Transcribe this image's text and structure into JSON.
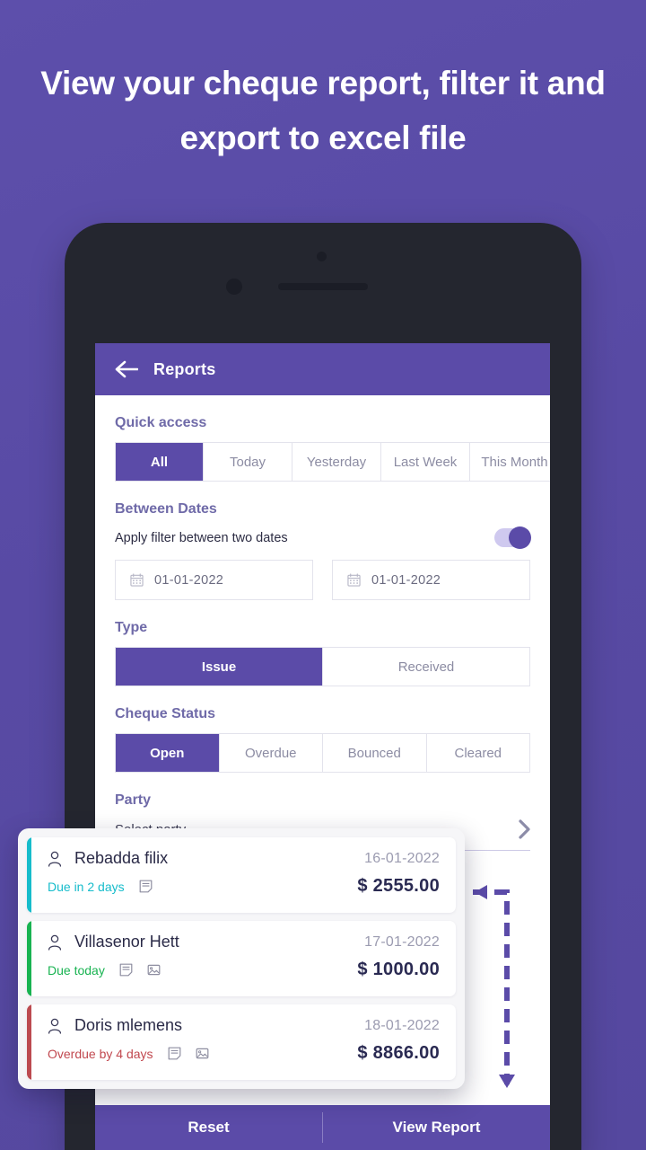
{
  "promo": {
    "headline": "View your cheque report, filter it and export to excel file",
    "background_color": "#584aa4"
  },
  "app": {
    "header": {
      "title": "Reports",
      "back_icon": "arrow-left-icon",
      "color": "#5b4ba8"
    },
    "quick_access": {
      "label": "Quick access",
      "options": [
        "All",
        "Today",
        "Yesterday",
        "Last Week",
        "This Month"
      ],
      "selected": "All"
    },
    "between_dates": {
      "label": "Between Dates",
      "filter_text": "Apply filter between two dates",
      "toggle_on": true,
      "from_date": "01-01-2022",
      "to_date": "01-01-2022",
      "calendar_icon": "calendar-icon"
    },
    "type": {
      "label": "Type",
      "options": [
        "Issue",
        "Received"
      ],
      "selected": "Issue"
    },
    "cheque_status": {
      "label": "Cheque Status",
      "options": [
        "Open",
        "Overdue",
        "Bounced",
        "Cleared"
      ],
      "selected": "Open"
    },
    "party": {
      "label": "Party",
      "placeholder": "Select party",
      "chevron_icon": "chevron-right-icon"
    },
    "bottom_bar": {
      "reset_label": "Reset",
      "view_report_label": "View Report"
    }
  },
  "cheque_list": {
    "items": [
      {
        "name": "Rebadda filix",
        "date": "16-01-2022",
        "status": "Due in 2 days",
        "status_color": "#16bccb",
        "accent_color": "#16bccb",
        "amount": "$ 2555.00",
        "icons": [
          "note-icon"
        ]
      },
      {
        "name": "Villasenor Hett",
        "date": "17-01-2022",
        "status": "Due today",
        "status_color": "#18b351",
        "accent_color": "#18b351",
        "amount": "$ 1000.00",
        "icons": [
          "note-icon",
          "image-icon"
        ]
      },
      {
        "name": "Doris mlemens",
        "date": "18-01-2022",
        "status": "Overdue by 4 days",
        "status_color": "#c1484f",
        "accent_color": "#bc4a50",
        "amount": "$ 8866.00",
        "icons": [
          "note-icon",
          "image-icon"
        ]
      }
    ]
  },
  "annotation": {
    "arrow_icon": "dashed-arrow",
    "arrow_color": "#5b4ba8"
  }
}
